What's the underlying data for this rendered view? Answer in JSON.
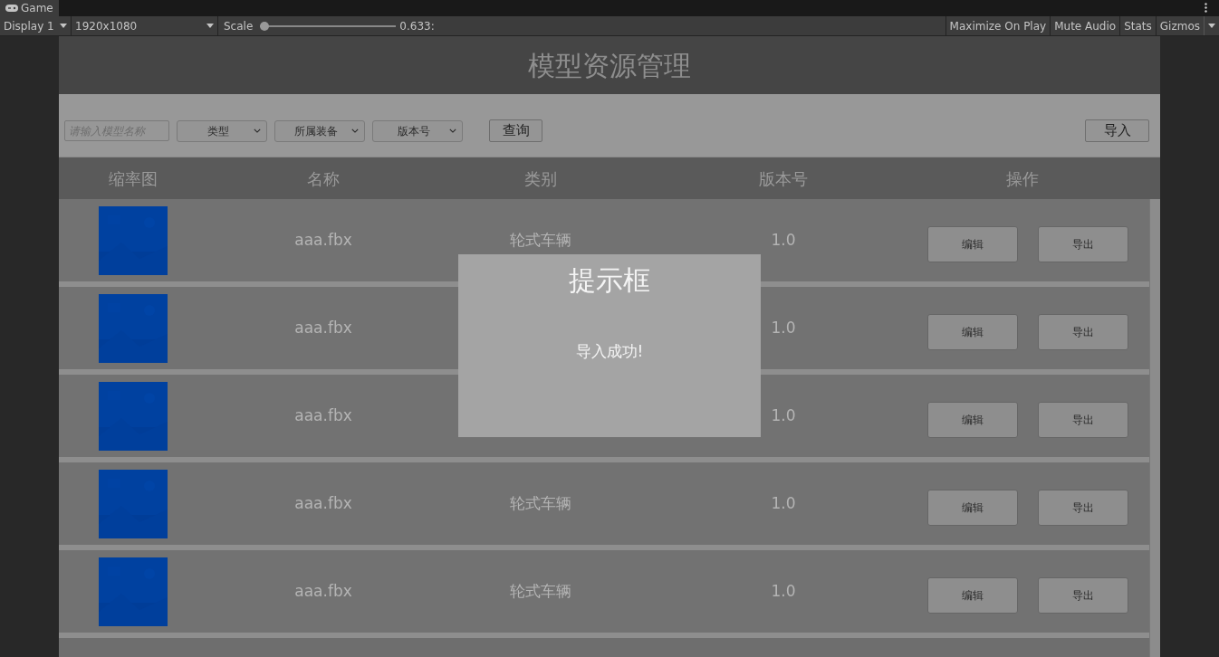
{
  "editor": {
    "tab": "Game",
    "display": "Display 1",
    "resolution": "1920x1080",
    "scale_label": "Scale",
    "scale": {
      "level": 0.0,
      "reading": "0.633:"
    },
    "toggles": [
      {
        "label": "Maximize On Play"
      },
      {
        "label": "Mute Audio"
      },
      {
        "label": "Stats"
      },
      {
        "label": "Gizmos"
      }
    ]
  },
  "app": {
    "title": "模型资源管理",
    "filters": {
      "search": {
        "placeholder": "请输入模型名称"
      },
      "dropdowns": [
        "类型",
        "所属装备",
        "版本号"
      ],
      "query_button": "查询",
      "import_button": "导入"
    },
    "columns": [
      "缩率图",
      "名称",
      "类别",
      "版本号",
      "操作"
    ],
    "rows": [
      {
        "kind": "picture",
        "name": "aaa.fbx",
        "category": "轮式车辆",
        "version": "1.0",
        "actions": [
          "编辑",
          "导出"
        ]
      },
      {
        "kind": "picture",
        "name": "aaa.fbx",
        "version": "1.0",
        "actions": [
          "编辑",
          "导出"
        ]
      },
      {
        "kind": "picture",
        "name": "aaa.fbx",
        "version": "1.0",
        "actions": [
          "编辑",
          "导出"
        ]
      },
      {
        "kind": "picture",
        "name": "aaa.fbx",
        "category": "轮式车辆",
        "version": "1.0",
        "actions": [
          "编辑",
          "导出"
        ]
      },
      {
        "kind": "picture",
        "name": "aaa.fbx",
        "category": "轮式车辆",
        "version": "1.0",
        "actions": [
          "编辑",
          "导出"
        ]
      }
    ]
  },
  "dialog": {
    "title": "提示框",
    "message": "导入成功!"
  }
}
